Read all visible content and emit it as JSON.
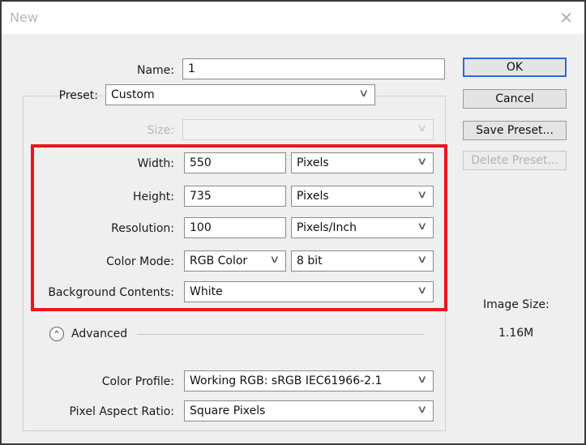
{
  "window": {
    "title": "New",
    "close_glyph": "✕"
  },
  "form": {
    "name": {
      "label": "Name:",
      "value": "1"
    },
    "preset": {
      "label": "Preset:",
      "value": "Custom"
    },
    "size": {
      "label": "Size:",
      "value": ""
    },
    "width": {
      "label": "Width:",
      "value": "550",
      "unit": "Pixels"
    },
    "height": {
      "label": "Height:",
      "value": "735",
      "unit": "Pixels"
    },
    "resolution": {
      "label": "Resolution:",
      "value": "100",
      "unit": "Pixels/Inch"
    },
    "color_mode": {
      "label": "Color Mode:",
      "value": "RGB Color",
      "depth": "8 bit"
    },
    "background": {
      "label": "Background Contents:",
      "value": "White"
    },
    "advanced": {
      "label": "Advanced",
      "icon": "collapse-chevron-up-icon"
    },
    "color_profile": {
      "label": "Color Profile:",
      "value": "Working RGB:  sRGB IEC61966-2.1"
    },
    "pixel_aspect": {
      "label": "Pixel Aspect Ratio:",
      "value": "Square Pixels"
    }
  },
  "buttons": {
    "ok": "OK",
    "cancel": "Cancel",
    "save_preset": "Save Preset...",
    "delete_preset": "Delete Preset..."
  },
  "image_size": {
    "label": "Image Size:",
    "value": "1.16M"
  },
  "chevron_glyph": "∨",
  "colors": {
    "highlight": "#e8171e",
    "default_button_border": "#2a6ad8"
  }
}
